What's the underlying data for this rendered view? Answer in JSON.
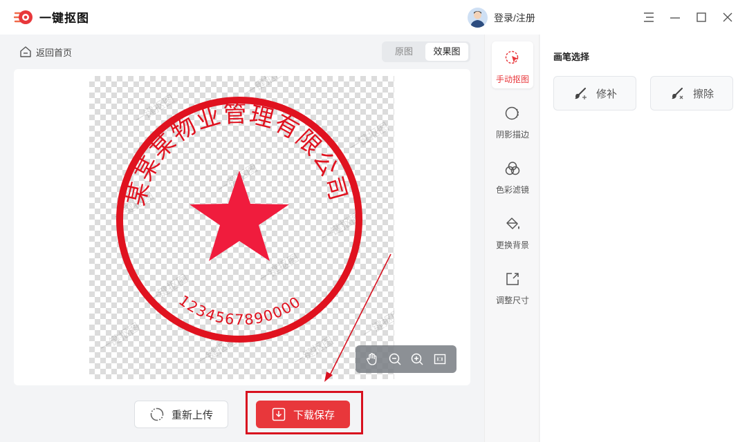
{
  "app": {
    "title": "一键抠图"
  },
  "header": {
    "login_label": "登录/注册"
  },
  "workspace": {
    "back_label": "返回首页",
    "tabs": [
      {
        "label": "原图"
      },
      {
        "label": "效果图",
        "active": true
      }
    ],
    "reupload_label": "重新上传",
    "save_label": "下载保存",
    "zoom_controls": [
      "hand-icon",
      "zoom-out-icon",
      "zoom-in-icon",
      "fit-icon"
    ]
  },
  "stamp": {
    "arc_text": "某某某物业管理有限公司",
    "number_text": "1234567890000",
    "watermark": "一键抠图",
    "color": "#e0121f",
    "star_color": "#f01c3d"
  },
  "tools": [
    {
      "label": "手动抠图",
      "icon": "cursor-icon",
      "active": true
    },
    {
      "label": "阴影描边",
      "icon": "shadow-icon"
    },
    {
      "label": "色彩滤镜",
      "icon": "filter-icon"
    },
    {
      "label": "更换背景",
      "icon": "paint-bucket-icon"
    },
    {
      "label": "调整尺寸",
      "icon": "resize-icon"
    }
  ],
  "panel": {
    "title": "画笔选择",
    "buttons": [
      {
        "label": "修补"
      },
      {
        "label": "擦除"
      }
    ]
  },
  "colors": {
    "accent": "#e8373b",
    "highlight": "#d8101f"
  }
}
